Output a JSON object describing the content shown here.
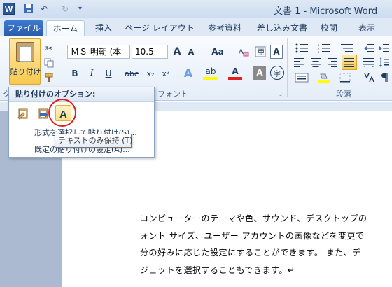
{
  "titlebar": {
    "app_icon": "W",
    "save_icon": "save-icon",
    "undo_glyph": "↶",
    "redo_glyph": "↻",
    "title": "文書 1 - Microsoft Word"
  },
  "tabs": {
    "file": "ファイル",
    "items": [
      "ホーム",
      "挿入",
      "ページ レイアウト",
      "参考資料",
      "差し込み文書",
      "校閲",
      "表示"
    ],
    "active": "ホーム"
  },
  "ribbon": {
    "paste_label": "貼り付け",
    "font_name": "ＭＳ 明朝 (本",
    "font_size": "10.5",
    "grow_font": "A",
    "shrink_font": "A",
    "change_case": "Aa",
    "bold": "B",
    "italic": "I",
    "underline": "U",
    "strike": "abc",
    "subscript": "x₂",
    "superscript": "x²",
    "text_effect": "A",
    "highlight": "ab",
    "font_color": "A",
    "char_shading": "A",
    "enclose": "字",
    "font_group_label": "フォント",
    "paragraph_group_label": "段落",
    "clipboard_group_label": "ク"
  },
  "popup": {
    "header": "貼り付けのオプション:",
    "options": [
      {
        "icon": "keep-source-formatting-icon"
      },
      {
        "icon": "merge-formatting-icon"
      },
      {
        "icon": "keep-text-only-icon",
        "glyph": "A"
      }
    ],
    "menu_items": [
      "形式を選択して貼り付け(S)...",
      "既定の貼り付けの設定(A)..."
    ]
  },
  "tooltip": "テキストのみ保持 (T)",
  "document": {
    "lines": [
      "コンピューターのテーマや色、サウンド、デスクトップの",
      "ォント サイズ、ユーザー アカウントの画像などを変更で",
      "分の好みに応じた設定にすることができます。 また、デ",
      "ジェットを選択することもできます。↵"
    ]
  },
  "colors": {
    "accent": "#2b5797",
    "highlight_circle": "#e0201c",
    "ribbon_bg": "#e4edf8"
  }
}
